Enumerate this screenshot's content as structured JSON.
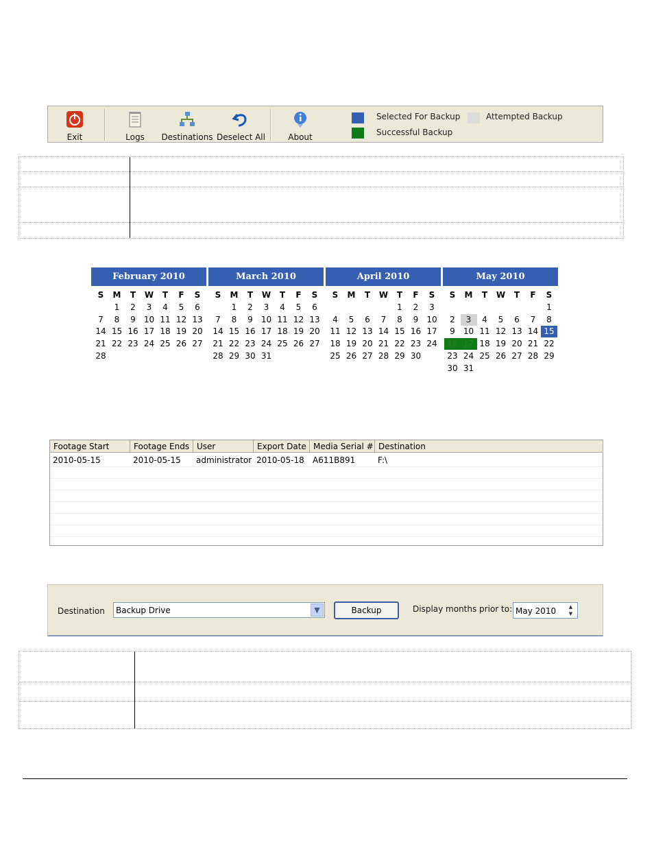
{
  "toolbar": {
    "exit_label": "Exit",
    "logs_label": "Logs",
    "destinations_label": "Destinations",
    "deselect_label": "Deselect All",
    "about_label": "About",
    "legend": {
      "selected": "Selected For Backup",
      "attempted": "Attempted Backup",
      "successful": "Successful Backup"
    },
    "colors": {
      "selected": "#3560b2",
      "attempted": "#d9d9d9",
      "successful": "#0f7a17"
    }
  },
  "calendar": {
    "dow": [
      "S",
      "M",
      "T",
      "W",
      "T",
      "F",
      "S"
    ],
    "months": [
      {
        "name": "February 2010",
        "first_dow": 1,
        "days": 28
      },
      {
        "name": "March 2010",
        "first_dow": 1,
        "days": 31
      },
      {
        "name": "April 2010",
        "first_dow": 4,
        "days": 30
      },
      {
        "name": "May 2010",
        "first_dow": 6,
        "days": 31,
        "selected": [
          15
        ],
        "successful": [
          16,
          17
        ],
        "attempted": [
          3
        ]
      }
    ]
  },
  "log_table": {
    "columns": [
      "Footage Start",
      "Footage Ends",
      "User",
      "Export Date",
      "Media Serial #",
      "Destination"
    ],
    "rows": [
      [
        "2010-05-15",
        "2010-05-15",
        "administrator",
        "2010-05-18",
        "A611B891",
        "F:\\"
      ]
    ]
  },
  "destination_panel": {
    "destination_label": "Destination",
    "destination_value": "Backup Drive",
    "backup_label": "Backup",
    "display_label": "Display months prior to:",
    "display_value": "May 2010"
  }
}
